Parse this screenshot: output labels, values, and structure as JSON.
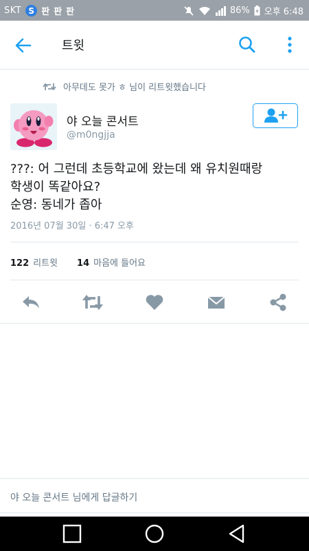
{
  "status_bar": {
    "carrier": "SKT",
    "notif_badge": "S",
    "app_icons": [
      "판",
      "판",
      "판"
    ],
    "battery": "86%",
    "time": "오후 6:48"
  },
  "header": {
    "title": "트윗"
  },
  "retweet_context": {
    "text": "아무데도 못가 ㅎ 님이 리트윗했습니다"
  },
  "author": {
    "name": "야 오늘 콘서트",
    "handle": "@m0ngjja"
  },
  "tweet": {
    "lines": [
      "???: 어 그런데 초등학교에 왔는데 왜 유치원때랑",
      "학생이 똑같아요?",
      "순영: 동네가 좁아"
    ],
    "timestamp": "2016년 07월 30일 · 6:47 오후"
  },
  "stats": {
    "retweets_count": "122",
    "retweets_label": "리트윗",
    "likes_count": "14",
    "likes_label": "마음에 들어요"
  },
  "reply": {
    "placeholder": "야 오늘 콘서트 님에게 답글하기"
  },
  "colors": {
    "accent": "#1da1f2",
    "status_bar": "#9aa1a8",
    "icon_gray": "#657786"
  },
  "icons": {
    "back": "arrow-left-icon",
    "search": "search-icon",
    "more": "more-vertical-icon",
    "follow": "add-user-icon",
    "reply": "reply-icon",
    "retweet": "retweet-icon",
    "like": "heart-icon",
    "dm": "envelope-icon",
    "share": "share-icon"
  }
}
